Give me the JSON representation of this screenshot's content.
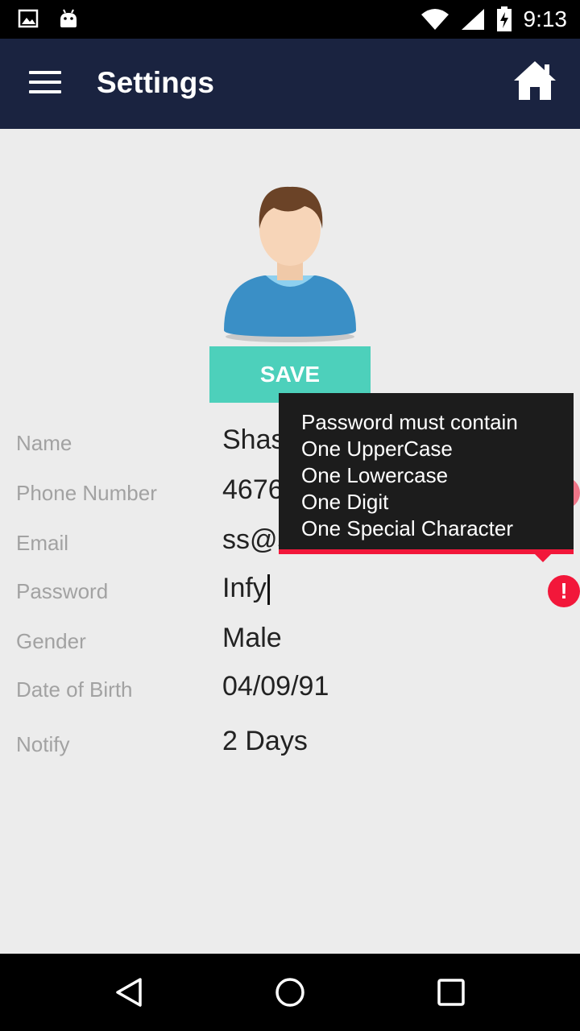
{
  "status_bar": {
    "time": "9:13",
    "left_icons": [
      "image-icon",
      "android-icon"
    ],
    "right_icons": [
      "wifi-icon",
      "signal-icon",
      "battery-charging-icon"
    ]
  },
  "app_bar": {
    "title": "Settings",
    "menu_icon": "hamburger-menu-icon",
    "home_icon": "home-icon",
    "background": "#1a2340"
  },
  "profile": {
    "avatar_icon": "user-avatar-icon",
    "save_label": "SAVE",
    "save_color": "#4dd0bb"
  },
  "fields": [
    {
      "label": "Name",
      "value": "Shashank"
    },
    {
      "label": "Phone Number",
      "value": "4676643434"
    },
    {
      "label": "Email",
      "value": "ss@ss.com"
    },
    {
      "label": "Password",
      "value": "Infy"
    },
    {
      "label": "Gender",
      "value": "Male"
    },
    {
      "label": "Date of Birth",
      "value": "04/09/91"
    },
    {
      "label": "Notify",
      "value": "2 Days"
    }
  ],
  "error_tooltip": {
    "lines": [
      "Password must contain",
      "One UpperCase",
      "One Lowercase",
      "One Digit",
      "One Special Character"
    ],
    "icon": "error-icon",
    "icon_glyph": "!",
    "error_color": "#f2173a"
  },
  "nav_bar": {
    "icons": [
      "back-icon",
      "home-circle-icon",
      "recents-icon"
    ]
  }
}
